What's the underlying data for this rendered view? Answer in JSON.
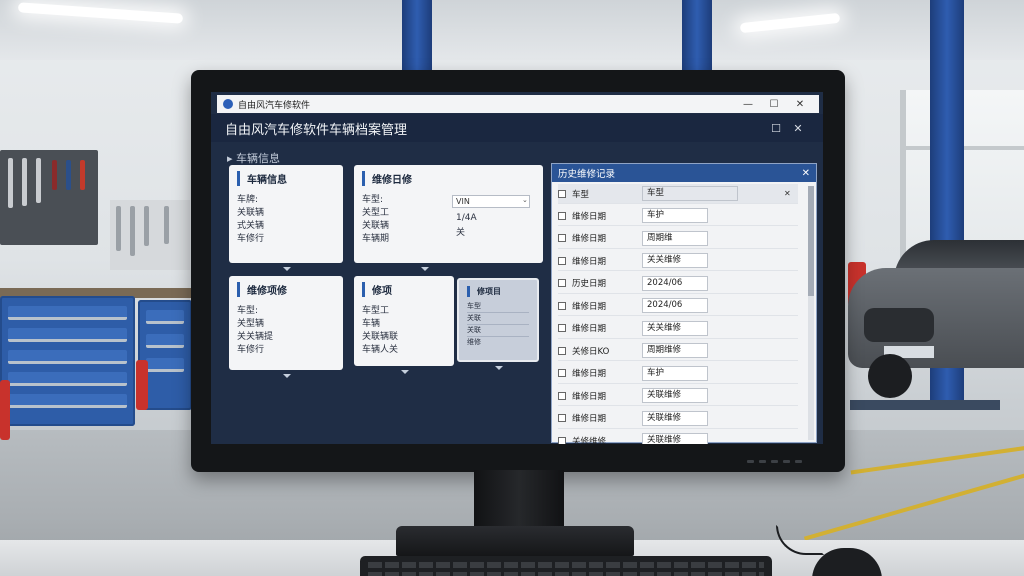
{
  "window": {
    "titlebar_title": "自由风汽车修软件",
    "title": "自由风汽车修软件车辆档案管理",
    "minimize_glyph": "—",
    "maximize_glyph": "☐",
    "close_glyph": "✕",
    "header_max_glyph": "☐",
    "header_close_glyph": "✕"
  },
  "breadcrumb": "▸ 车辆信息",
  "cards": {
    "vehicle": {
      "title": "车辆信息",
      "rows": [
        "车牌:",
        "关联辆",
        "式关辆",
        "车修行"
      ]
    },
    "service_date": {
      "title": "维修日修",
      "rows": [
        "车型:",
        "关型工",
        "关联辆",
        "车辆期"
      ],
      "inputs": [
        "VIN",
        "1/4A",
        "关"
      ]
    },
    "repair": {
      "title": "维修项修",
      "rows": [
        "车型:",
        "关型辆",
        "关关辆提",
        "车修行"
      ]
    },
    "project": {
      "title": "修项",
      "rows": [
        "车型工",
        "车辆",
        "关联辆联",
        "车辆人关"
      ]
    },
    "popup": {
      "title": "修项目",
      "rows": [
        "车型",
        "关联",
        "关联",
        "维修"
      ]
    }
  },
  "history_panel": {
    "title": "历史维修记录",
    "close_glyph": "✕",
    "header_row": {
      "key": "车型",
      "value": "车型",
      "close": "✕"
    },
    "rows": [
      {
        "key": "维修日期",
        "value": "车护"
      },
      {
        "key": "维修日期",
        "value": "周期维"
      },
      {
        "key": "维修日期",
        "value": "关关维修"
      },
      {
        "key": "历史日期",
        "value": "2024/06"
      },
      {
        "key": "维修日期",
        "value": "2024/06"
      },
      {
        "key": "维修日期",
        "value": "关关维修"
      },
      {
        "key": "关修日KO",
        "value": "周期维修"
      },
      {
        "key": "维修日期",
        "value": "车护"
      },
      {
        "key": "维修日期",
        "value": "关联维修"
      },
      {
        "key": "维修日期",
        "value": "关联维修"
      },
      {
        "key": "关修维修",
        "value": "关联维修"
      }
    ]
  }
}
